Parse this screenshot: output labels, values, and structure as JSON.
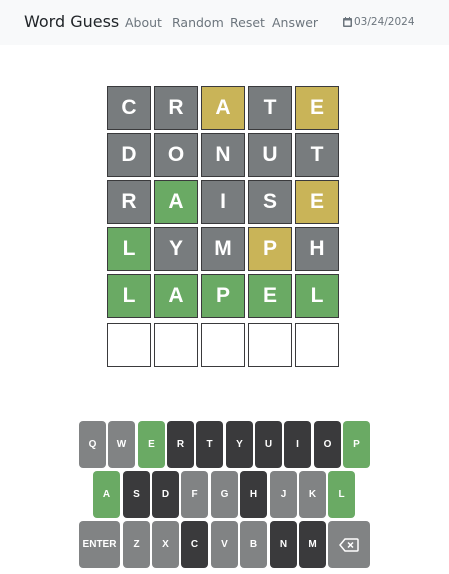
{
  "nav": {
    "brand": "Word Guess",
    "links": [
      "About",
      "Random",
      "Reset",
      "Answer"
    ],
    "date": "03/24/2024"
  },
  "colors": {
    "correct": "#6aaa64",
    "present": "#c9b458",
    "absent": "#787c7e",
    "key_absent": "#3a3a3c",
    "key_unused": "#818384"
  },
  "board": [
    [
      {
        "letter": "C",
        "state": "absent"
      },
      {
        "letter": "R",
        "state": "absent"
      },
      {
        "letter": "A",
        "state": "present"
      },
      {
        "letter": "T",
        "state": "absent"
      },
      {
        "letter": "E",
        "state": "present"
      }
    ],
    [
      {
        "letter": "D",
        "state": "absent"
      },
      {
        "letter": "O",
        "state": "absent"
      },
      {
        "letter": "N",
        "state": "absent"
      },
      {
        "letter": "U",
        "state": "absent"
      },
      {
        "letter": "T",
        "state": "absent"
      }
    ],
    [
      {
        "letter": "R",
        "state": "absent"
      },
      {
        "letter": "A",
        "state": "correct"
      },
      {
        "letter": "I",
        "state": "absent"
      },
      {
        "letter": "S",
        "state": "absent"
      },
      {
        "letter": "E",
        "state": "present"
      }
    ],
    [
      {
        "letter": "L",
        "state": "correct"
      },
      {
        "letter": "Y",
        "state": "absent"
      },
      {
        "letter": "M",
        "state": "absent"
      },
      {
        "letter": "P",
        "state": "present"
      },
      {
        "letter": "H",
        "state": "absent"
      }
    ],
    [
      {
        "letter": "L",
        "state": "correct"
      },
      {
        "letter": "A",
        "state": "correct"
      },
      {
        "letter": "P",
        "state": "correct"
      },
      {
        "letter": "E",
        "state": "correct"
      },
      {
        "letter": "L",
        "state": "correct"
      }
    ],
    [
      {
        "letter": "",
        "state": "empty"
      },
      {
        "letter": "",
        "state": "empty"
      },
      {
        "letter": "",
        "state": "empty"
      },
      {
        "letter": "",
        "state": "empty"
      },
      {
        "letter": "",
        "state": "empty"
      }
    ]
  ],
  "keyboard": {
    "row1": [
      {
        "label": "Q",
        "state": "unused"
      },
      {
        "label": "W",
        "state": "unused"
      },
      {
        "label": "E",
        "state": "correct"
      },
      {
        "label": "R",
        "state": "absent"
      },
      {
        "label": "T",
        "state": "absent"
      },
      {
        "label": "Y",
        "state": "absent"
      },
      {
        "label": "U",
        "state": "absent"
      },
      {
        "label": "I",
        "state": "absent"
      },
      {
        "label": "O",
        "state": "absent"
      },
      {
        "label": "P",
        "state": "correct"
      }
    ],
    "row2": [
      {
        "label": "A",
        "state": "correct"
      },
      {
        "label": "S",
        "state": "absent"
      },
      {
        "label": "D",
        "state": "absent"
      },
      {
        "label": "F",
        "state": "unused"
      },
      {
        "label": "G",
        "state": "unused"
      },
      {
        "label": "H",
        "state": "absent"
      },
      {
        "label": "J",
        "state": "unused"
      },
      {
        "label": "K",
        "state": "unused"
      },
      {
        "label": "L",
        "state": "correct"
      }
    ],
    "row3": [
      {
        "label": "ENTER",
        "state": "unused"
      },
      {
        "label": "Z",
        "state": "unused"
      },
      {
        "label": "X",
        "state": "unused"
      },
      {
        "label": "C",
        "state": "absent"
      },
      {
        "label": "V",
        "state": "unused"
      },
      {
        "label": "B",
        "state": "unused"
      },
      {
        "label": "N",
        "state": "absent"
      },
      {
        "label": "M",
        "state": "absent"
      },
      {
        "label": "backspace-icon",
        "state": "unused"
      }
    ]
  }
}
